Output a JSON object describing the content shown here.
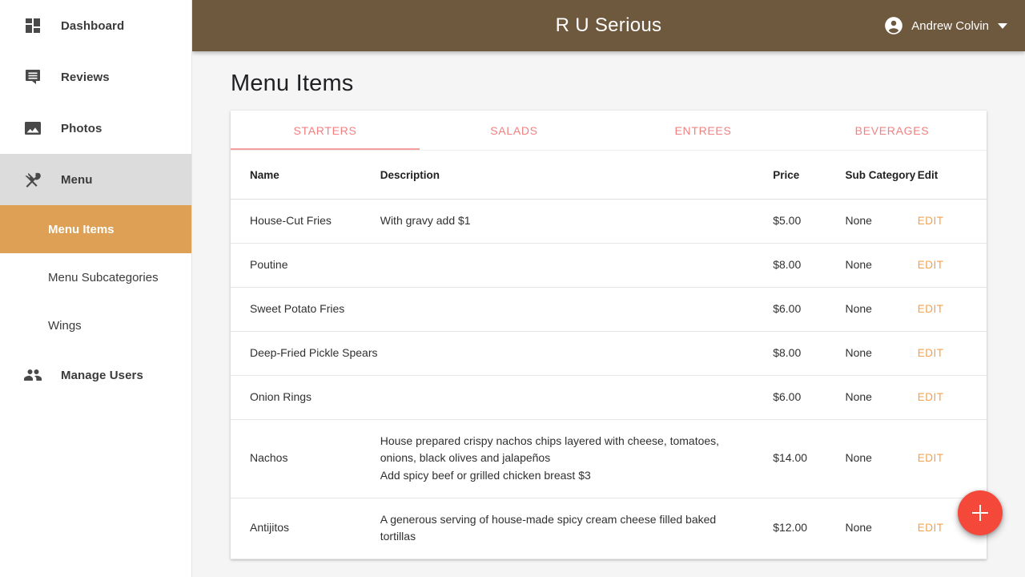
{
  "header": {
    "brand": "R U Serious",
    "account_name": "Andrew Colvin",
    "avatar_icon": "account-circle-icon",
    "caret_icon": "chevron-down-icon"
  },
  "sidebar": {
    "items": [
      {
        "label": "Dashboard",
        "icon": "dashboard-grid-icon",
        "active": false
      },
      {
        "label": "Reviews",
        "icon": "chat-bubble-icon",
        "active": false
      },
      {
        "label": "Photos",
        "icon": "photo-image-icon",
        "active": false
      },
      {
        "label": "Menu",
        "icon": "restaurant-utensils-icon",
        "active": true
      },
      {
        "label": "Manage Users",
        "icon": "people-group-icon",
        "active": false
      }
    ],
    "submenu": [
      {
        "label": "Menu Items",
        "active": true
      },
      {
        "label": "Menu Subcategories",
        "active": false
      },
      {
        "label": "Wings",
        "active": false
      }
    ]
  },
  "main": {
    "page_title": "Menu Items",
    "tabs": [
      {
        "label": "STARTERS",
        "active": true
      },
      {
        "label": "SALADS",
        "active": false
      },
      {
        "label": "ENTREES",
        "active": false
      },
      {
        "label": "BEVERAGES",
        "active": false
      }
    ],
    "table": {
      "columns": [
        "Name",
        "Description",
        "Price",
        "Sub Category",
        "Edit"
      ],
      "edit_label": "EDIT",
      "rows": [
        {
          "name": "House-Cut Fries",
          "description": [
            "With gravy add $1"
          ],
          "price": "$5.00",
          "subcategory": "None"
        },
        {
          "name": "Poutine",
          "description": [],
          "price": "$8.00",
          "subcategory": "None"
        },
        {
          "name": "Sweet Potato Fries",
          "description": [],
          "price": "$6.00",
          "subcategory": "None"
        },
        {
          "name": "Deep-Fried Pickle Spears",
          "description": [],
          "price": "$8.00",
          "subcategory": "None"
        },
        {
          "name": "Onion Rings",
          "description": [],
          "price": "$6.00",
          "subcategory": "None"
        },
        {
          "name": "Nachos",
          "description": [
            "House prepared crispy nachos chips layered with cheese, tomatoes,",
            "onions, black olives and jalapeños",
            "Add spicy beef or grilled chicken breast $3"
          ],
          "price": "$14.00",
          "subcategory": "None"
        },
        {
          "name": "Antijitos",
          "description": [
            "A generous serving of house-made spicy cream cheese filled baked",
            "tortillas"
          ],
          "price": "$12.00",
          "subcategory": "None"
        }
      ]
    },
    "fab": {
      "icon": "plus-icon",
      "label": "+"
    }
  },
  "colors": {
    "topbar_brown": "#6e583e",
    "sidebar_active": "#dda055",
    "sidebar_section_active": "#dcdcdc",
    "tab_text": "#f28080",
    "tab_underline": "#f4a0a0",
    "edit_link": "#f5a04a",
    "fab_red": "#f4483a",
    "page_background": "#f5f5f5"
  }
}
